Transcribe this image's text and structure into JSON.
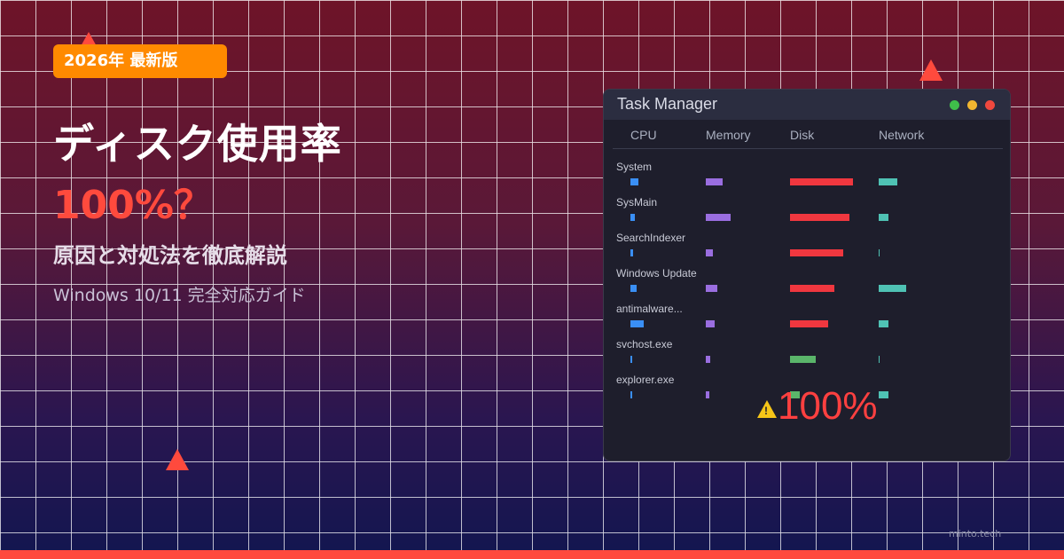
{
  "hero": {
    "badge": "2026年 最新版",
    "title_line1": "ディスク使用率",
    "title_line2": "100%？",
    "subtitle": "原因と対処法を徹底解説",
    "subtitle2": "Windows 10/11 完全対応ガイド"
  },
  "task_manager": {
    "title": "Task Manager",
    "columns": [
      "CPU",
      "Memory",
      "Disk",
      "Network"
    ],
    "processes": [
      {
        "name": "System"
      },
      {
        "name": "SysMain"
      },
      {
        "name": "SearchIndexer"
      },
      {
        "name": "Windows Update"
      },
      {
        "name": "antimalware..."
      },
      {
        "name": "svchost.exe"
      },
      {
        "name": "explorer.exe"
      }
    ],
    "overlay_value": "100%"
  },
  "footer": {
    "site": "minto.tech"
  },
  "colors": {
    "accent": "#ff4a3d",
    "badge": "#ff8a00",
    "cpu": "#3a8ff5",
    "memory": "#9a6ee0",
    "disk_high": "#f0373f",
    "disk_low": "#5ab56a",
    "network": "#4fc2b4"
  },
  "icons": {
    "warning": "warning-triangle-icon",
    "window_controls": [
      "green-dot",
      "yellow-dot",
      "red-dot"
    ]
  }
}
